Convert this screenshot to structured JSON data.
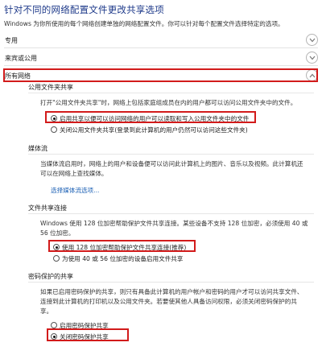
{
  "page": {
    "title": "针对不同的网络配置文件更改共享选项",
    "intro": "Windows 为你所使用的每个网络创建单独的网络配置文件。你可以针对每个配置文件选择特定的选项。"
  },
  "profiles": {
    "private": "专用",
    "guest_public": "来宾或公用",
    "all_networks": "所有网络"
  },
  "public_folder_sharing": {
    "heading": "公用文件夹共享",
    "description": "打开\"公用文件夹共享\"时，网络上包括家庭组成员在内的用户都可以访问公用文件夹中的文件。",
    "options": [
      "启用共享以便可以访问网络的用户可以读取和写入公用文件夹中的文件",
      "关闭公用文件夹共享(登录到此计算机的用户仍然可以访问这些文件夹)"
    ]
  },
  "media_streaming": {
    "heading": "媒体流",
    "description_line1": "当媒体流启用时，网络上的用户和设备便可以访问此计算机上的图片、音乐以及视频。此计算机还",
    "description_line2": "可以在网络上查找媒体。",
    "link": "选择媒体流选项..."
  },
  "file_sharing_connections": {
    "heading": "文件共享连接",
    "description_line1": "Windows 使用 128 位加密帮助保护文件共享连接。某些设备不支持 128 位加密，必须使用 40 或",
    "description_line2": "56 位加密。",
    "options": [
      "使用 128 位加密帮助保护文件共享连接(推荐)",
      "为使用 40 或 56 位加密的设备启用文件共享"
    ]
  },
  "password_protected_sharing": {
    "heading": "密码保护的共享",
    "description_line1": "如果已启用密码保护的共享，则只有具备此计算机的用户帐户和密码的用户才可以访问共享文件、",
    "description_line2": "连接到此计算机的打印机以及公用文件夹。若要使其他人具备访问权限，必须关闭密码保护的共",
    "description_line3": "享。",
    "options": [
      "启用密码保护共享",
      "关闭密码保护共享"
    ]
  },
  "colors": {
    "highlight": "#d21b1b",
    "title": "#1e3a8a",
    "link": "#1a5fb4"
  }
}
